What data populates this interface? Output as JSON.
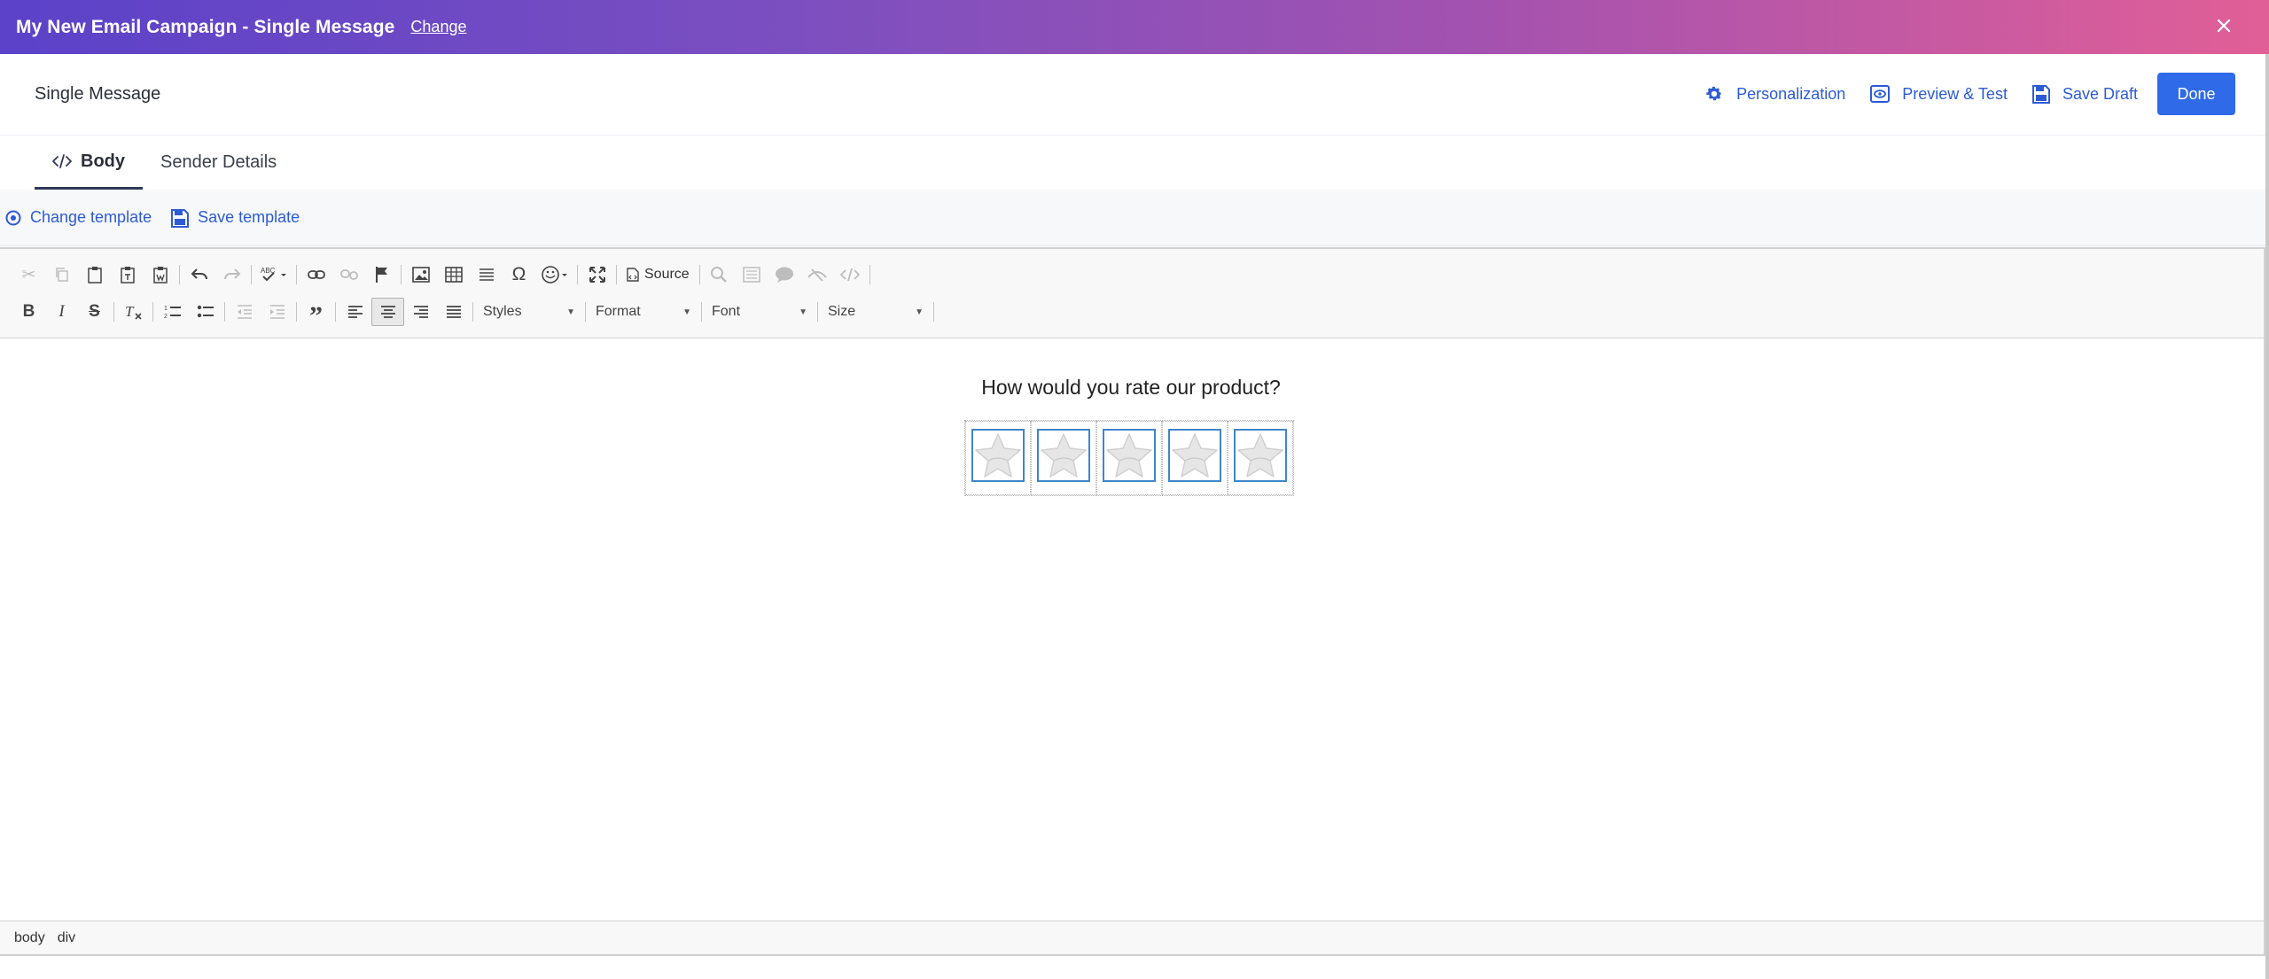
{
  "topbar": {
    "title": "My New Email Campaign - Single Message",
    "change_label": "Change",
    "gradient_start": "#5b42c9",
    "gradient_end": "#e15f97"
  },
  "header": {
    "label": "Single Message",
    "actions": {
      "personalization": "Personalization",
      "preview": "Preview & Test",
      "save_draft": "Save Draft",
      "done": "Done"
    },
    "accent_color": "#2f6ae8"
  },
  "tabs": [
    {
      "label": "Body",
      "active": true,
      "icon": "code-icon"
    },
    {
      "label": "Sender Details",
      "active": false
    }
  ],
  "template_bar": {
    "change_template": "Change template",
    "save_template": "Save template"
  },
  "toolbar": {
    "row1": [
      "cut-icon",
      "copy-icon",
      "paste-icon",
      "paste-text-icon",
      "paste-word-icon",
      "undo-icon",
      "redo-icon",
      "spellcheck-icon",
      "link-icon",
      "unlink-icon",
      "anchor-icon",
      "image-icon",
      "table-icon",
      "horizontal-rule-icon",
      "special-char-icon",
      "emoji-icon",
      "maximize-icon",
      "search-icon",
      "select-all-icon",
      "comment-icon",
      "hide-icon",
      "code-icon"
    ],
    "source_label": "Source",
    "combos": {
      "styles": "Styles",
      "format": "Format",
      "font": "Font",
      "size": "Size"
    }
  },
  "content": {
    "question": "How would you rate our product?",
    "star_count": 5
  },
  "statusbar": {
    "path": [
      "body",
      "div"
    ]
  }
}
